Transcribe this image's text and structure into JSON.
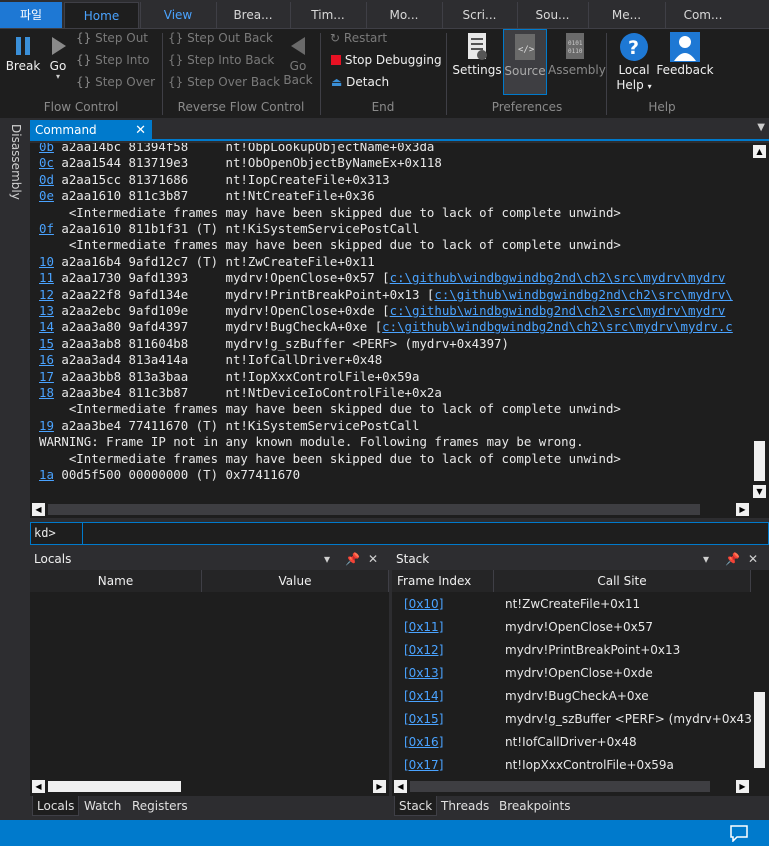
{
  "tabs": [
    "파일",
    "Home",
    "View",
    "Brea...",
    "Tim...",
    "Mo...",
    "Scri...",
    "Sou...",
    "Me...",
    "Com..."
  ],
  "ribbon": {
    "flow_control": {
      "break": "Break",
      "go": "Go",
      "step_out": "Step Out",
      "step_into": "Step Into",
      "step_over": "Step Over",
      "label": "Flow Control"
    },
    "reverse_flow": {
      "step_out_back": "Step Out Back",
      "step_into_back": "Step Into Back",
      "step_over_back": "Step Over Back",
      "go_back_1": "Go",
      "go_back_2": "Back",
      "label": "Reverse Flow Control"
    },
    "end": {
      "restart": "Restart",
      "stop_debugging": "Stop Debugging",
      "detach": "Detach",
      "label": "End"
    },
    "preferences": {
      "settings": "Settings",
      "source": "Source",
      "assembly": "Assembly",
      "label": "Preferences"
    },
    "help": {
      "local_help_1": "Local",
      "local_help_2": "Help",
      "feedback": "Feedback",
      "label": "Help"
    }
  },
  "side_tab": "Disassembly",
  "command": {
    "tab_label": "Command",
    "prompt": "kd>",
    "lines": [
      {
        "frame": "0b",
        "text": " a2aa14bc 81394f58     nt!ObpLookupObjectName+0x3da",
        "link": ""
      },
      {
        "frame": "0c",
        "text": " a2aa1544 813719e3     nt!ObOpenObjectByNameEx+0x118",
        "link": ""
      },
      {
        "frame": "0d",
        "text": " a2aa15cc 81371686     nt!IopCreateFile+0x313",
        "link": ""
      },
      {
        "frame": "0e",
        "text": " a2aa1610 811c3b87     nt!NtCreateFile+0x36",
        "link": ""
      },
      {
        "frame": "",
        "text": "    <Intermediate frames may have been skipped due to lack of complete unwind>",
        "link": ""
      },
      {
        "frame": "0f",
        "text": " a2aa1610 811b1f31 (T) nt!KiSystemServicePostCall",
        "link": ""
      },
      {
        "frame": "",
        "text": "    <Intermediate frames may have been skipped due to lack of complete unwind>",
        "link": ""
      },
      {
        "frame": "10",
        "text": " a2aa16b4 9afd12c7 (T) nt!ZwCreateFile+0x11",
        "link": ""
      },
      {
        "frame": "11",
        "text": " a2aa1730 9afd1393     mydrv!OpenClose+0x57 [",
        "link": "c:\\github\\windbgwindbg2nd\\ch2\\src\\mydrv\\mydrv"
      },
      {
        "frame": "12",
        "text": " a2aa22f8 9afd134e     mydrv!PrintBreakPoint+0x13 [",
        "link": "c:\\github\\windbgwindbg2nd\\ch2\\src\\mydrv\\"
      },
      {
        "frame": "13",
        "text": " a2aa2ebc 9afd109e     mydrv!OpenClose+0xde [",
        "link": "c:\\github\\windbgwindbg2nd\\ch2\\src\\mydrv\\mydrv"
      },
      {
        "frame": "14",
        "text": " a2aa3a80 9afd4397     mydrv!BugCheckA+0xe [",
        "link": "c:\\github\\windbgwindbg2nd\\ch2\\src\\mydrv\\mydrv.c"
      },
      {
        "frame": "15",
        "text": " a2aa3ab8 811604b8     mydrv!g_szBuffer <PERF> (mydrv+0x4397)",
        "link": ""
      },
      {
        "frame": "16",
        "text": " a2aa3ad4 813a414a     nt!IofCallDriver+0x48",
        "link": ""
      },
      {
        "frame": "17",
        "text": " a2aa3bb8 813a3baa     nt!IopXxxControlFile+0x59a",
        "link": ""
      },
      {
        "frame": "18",
        "text": " a2aa3be4 811c3b87     nt!NtDeviceIoControlFile+0x2a",
        "link": ""
      },
      {
        "frame": "",
        "text": "    <Intermediate frames may have been skipped due to lack of complete unwind>",
        "link": ""
      },
      {
        "frame": "19",
        "text": " a2aa3be4 77411670 (T) nt!KiSystemServicePostCall",
        "link": ""
      },
      {
        "frame": "",
        "text": "WARNING: Frame IP not in any known module. Following frames may be wrong.",
        "link": ""
      },
      {
        "frame": "",
        "text": "    <Intermediate frames may have been skipped due to lack of complete unwind>",
        "link": ""
      },
      {
        "frame": "1a",
        "text": " 00d5f500 00000000 (T) 0x77411670",
        "link": ""
      }
    ]
  },
  "locals_panel": {
    "title": "Locals",
    "columns": [
      "Name",
      "Value"
    ],
    "tabs": [
      "Locals",
      "Watch",
      "Registers"
    ]
  },
  "stack_panel": {
    "title": "Stack",
    "columns": [
      "Frame Index",
      "Call Site"
    ],
    "rows": [
      {
        "index": "[0x10]",
        "site": "nt!ZwCreateFile+0x11"
      },
      {
        "index": "[0x11]",
        "site": "mydrv!OpenClose+0x57"
      },
      {
        "index": "[0x12]",
        "site": "mydrv!PrintBreakPoint+0x13"
      },
      {
        "index": "[0x13]",
        "site": "mydrv!OpenClose+0xde"
      },
      {
        "index": "[0x14]",
        "site": "mydrv!BugCheckA+0xe"
      },
      {
        "index": "[0x15]",
        "site": "mydrv!g_szBuffer <PERF> (mydrv+0x4397)"
      },
      {
        "index": "[0x16]",
        "site": "nt!IofCallDriver+0x48"
      },
      {
        "index": "[0x17]",
        "site": "nt!IopXxxControlFile+0x59a"
      }
    ],
    "tabs": [
      "Stack",
      "Threads",
      "Breakpoints"
    ]
  },
  "colors": {
    "accent": "#007acc",
    "link": "#4aa3ff",
    "background": "#1e1e1e",
    "chrome": "#2d2d30"
  }
}
